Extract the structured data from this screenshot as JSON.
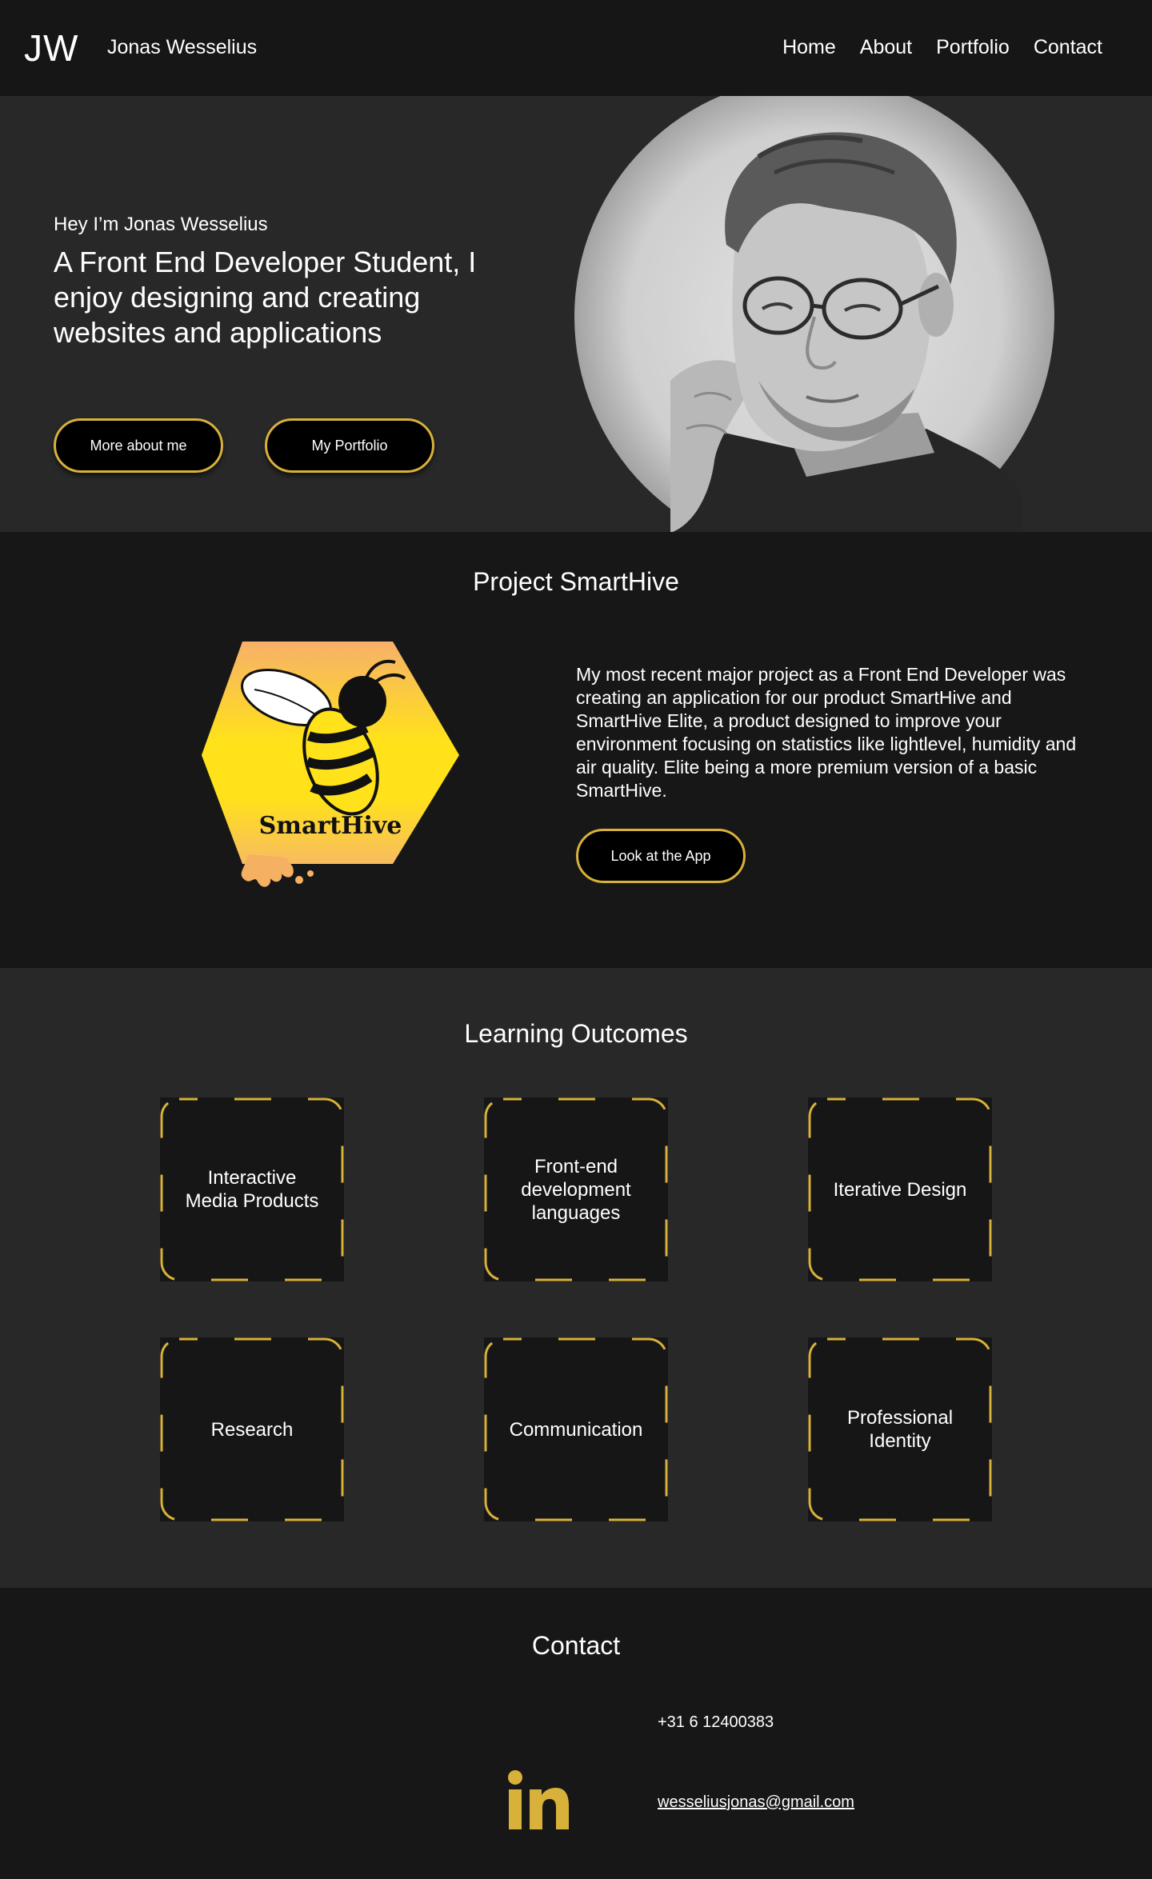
{
  "header": {
    "logo": "JW",
    "name": "Jonas Wesselius",
    "nav": [
      "Home",
      "About",
      "Portfolio",
      "Contact"
    ]
  },
  "hero": {
    "greeting": "Hey I’m Jonas Wesselius",
    "title": "A Front End Developer Student, I enjoy designing and creating websites and applications",
    "btn_about": "More about me",
    "btn_portfolio": "My Portfolio"
  },
  "project": {
    "title": "Project SmartHive",
    "logo_text": "SmartHive",
    "description": "My most recent major project as a Front End Developer was creating an application for our product SmartHive and SmartHive Elite, a product designed to improve your environment focusing on statistics like lightlevel, humidity and air quality. Elite being a more premium version of a basic SmartHive.",
    "button": "Look at the App"
  },
  "outcomes": {
    "title": "Learning Outcomes",
    "items": [
      "Interactive Media Products",
      "Front-end development languages",
      "Iterative Design",
      "Research",
      "Communication",
      "Professional Identity"
    ]
  },
  "contact": {
    "title": "Contact",
    "phone": "+31 6 12400383",
    "email": "wesseliusjonas@gmail.com",
    "linkedin_text": "in"
  },
  "colors": {
    "accent": "#d8b13a",
    "background": "#171717",
    "panel": "#282828"
  },
  "icons": {
    "linkedin": "linkedin-icon",
    "smarthive": "smarthive-bee-logo"
  }
}
